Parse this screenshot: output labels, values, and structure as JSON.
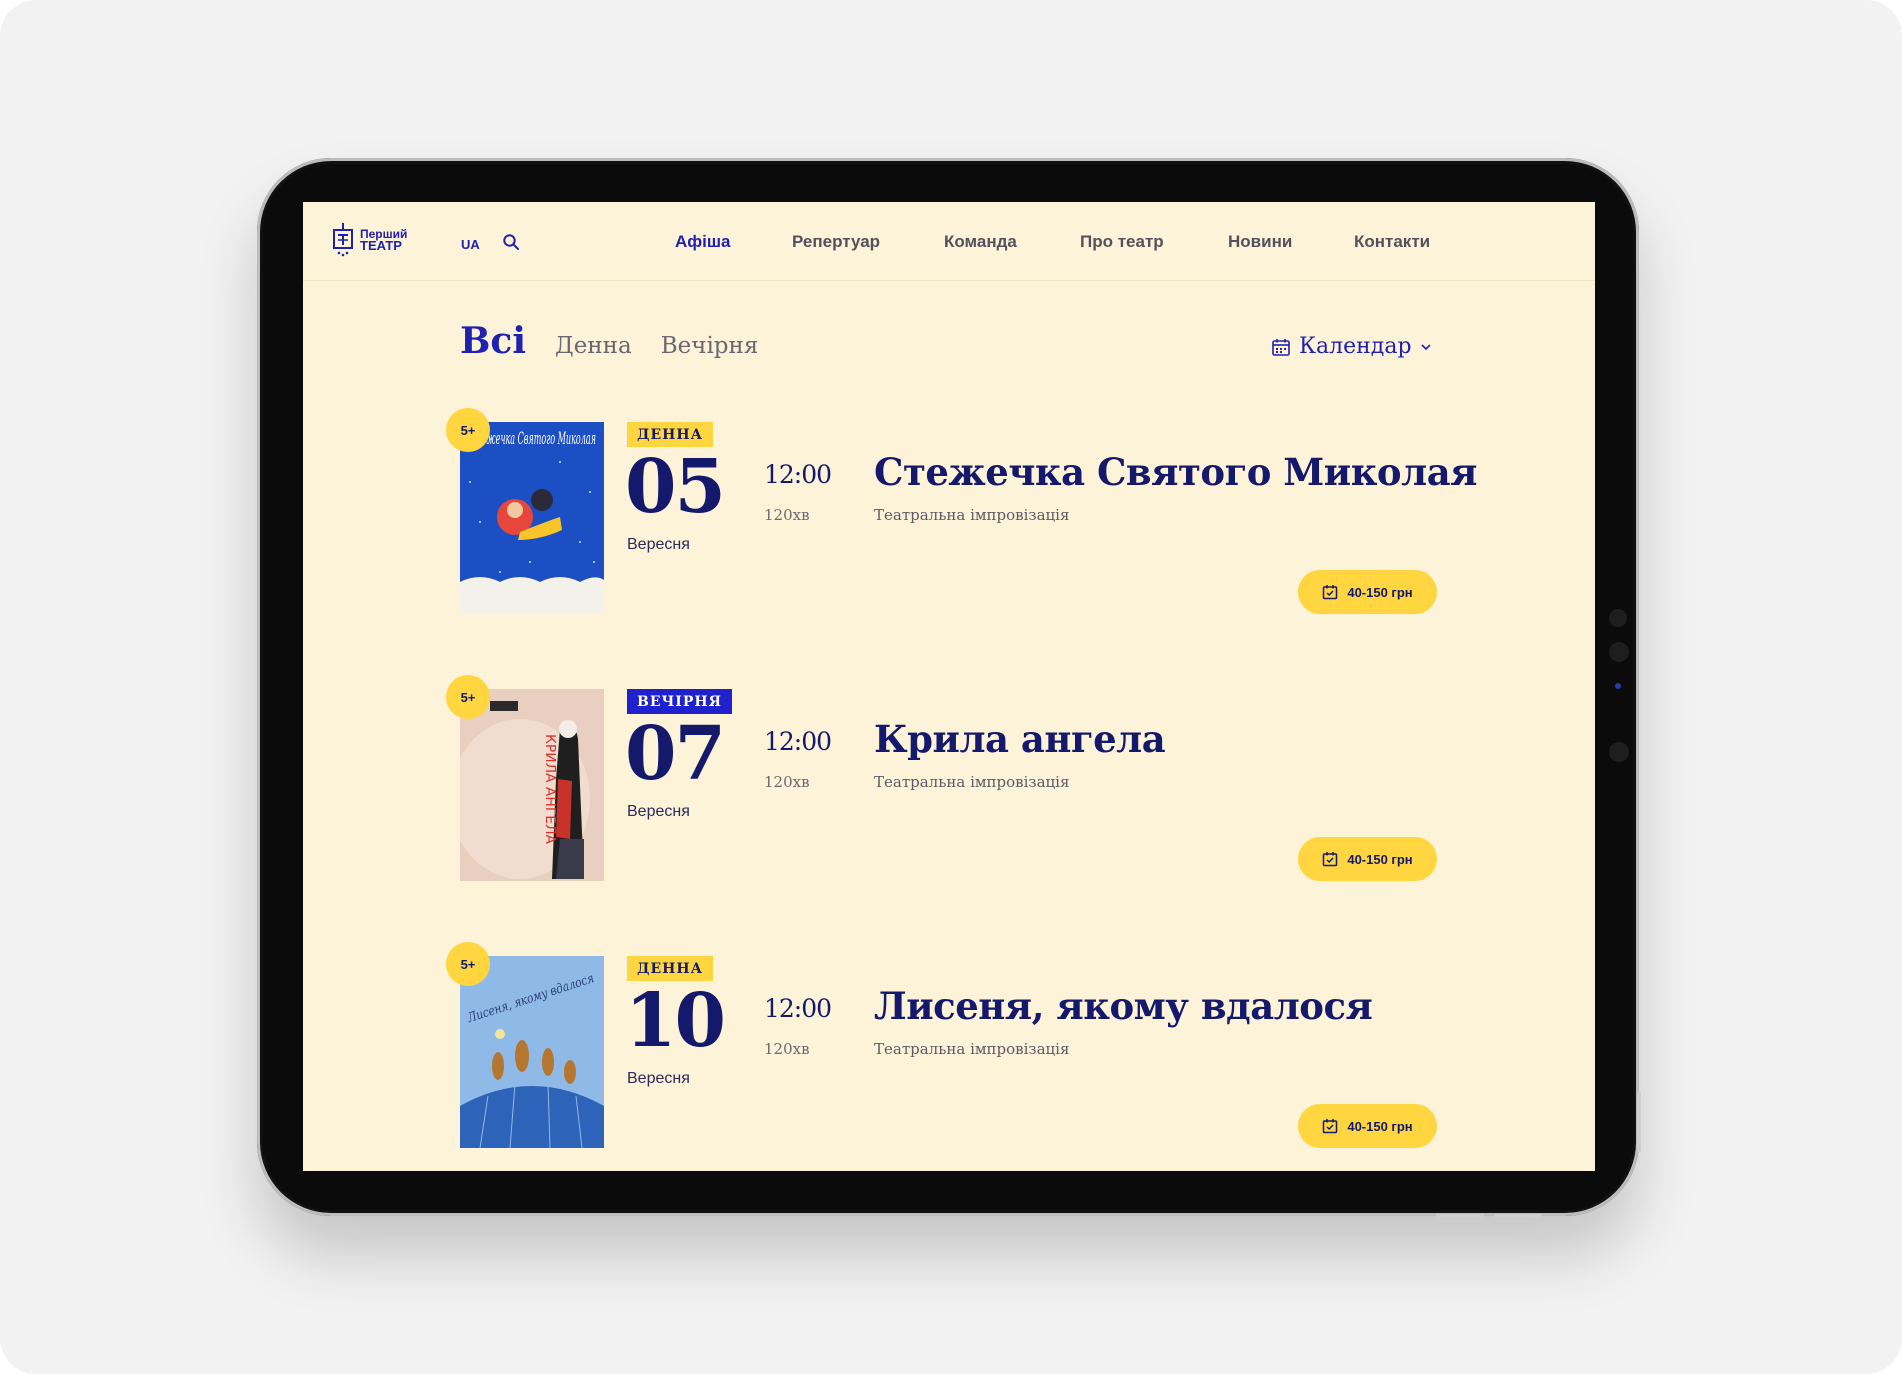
{
  "header": {
    "logo_line1": "Перший",
    "logo_line2": "ТЕАТР",
    "lang": "UA",
    "nav": [
      "Афіша",
      "Репертуар",
      "Команда",
      "Про театр",
      "Новини",
      "Контакти"
    ],
    "active_nav": "Афіша"
  },
  "filters": {
    "items": [
      "Всі",
      "Денна",
      "Вечірня"
    ],
    "active": "Всі",
    "calendar_label": "Календар"
  },
  "events": [
    {
      "age": "5+",
      "tag": "ДЕННА",
      "day": "05",
      "month": "Вересня",
      "time": "12:00",
      "duration": "120хв",
      "title": "Стежечка Святого Миколая",
      "genre": "Театральна імпровізація",
      "price": "40-150 грн",
      "poster_text": "Стежечка Святого Миколая"
    },
    {
      "age": "5+",
      "tag": "ВЕЧІРНЯ",
      "day": "07",
      "month": "Вересня",
      "time": "12:00",
      "duration": "120хв",
      "title": "Крила ангела",
      "genre": "Театральна імпровізація",
      "price": "40-150 грн",
      "poster_text": "КРИЛА АНГЕЛА"
    },
    {
      "age": "5+",
      "tag": "ДЕННА",
      "day": "10",
      "month": "Вересня",
      "time": "12:00",
      "duration": "120хв",
      "title": "Лисеня, якому вдалося",
      "genre": "Театральна імпровізація",
      "price": "40-150 грн",
      "poster_text": "Лисеня, якому вдалося"
    }
  ],
  "colors": {
    "brand_blue": "#1f22b0",
    "accent_yellow": "#ffd63f",
    "page_bg": "#fdf3d9",
    "title_navy": "#15196b"
  }
}
